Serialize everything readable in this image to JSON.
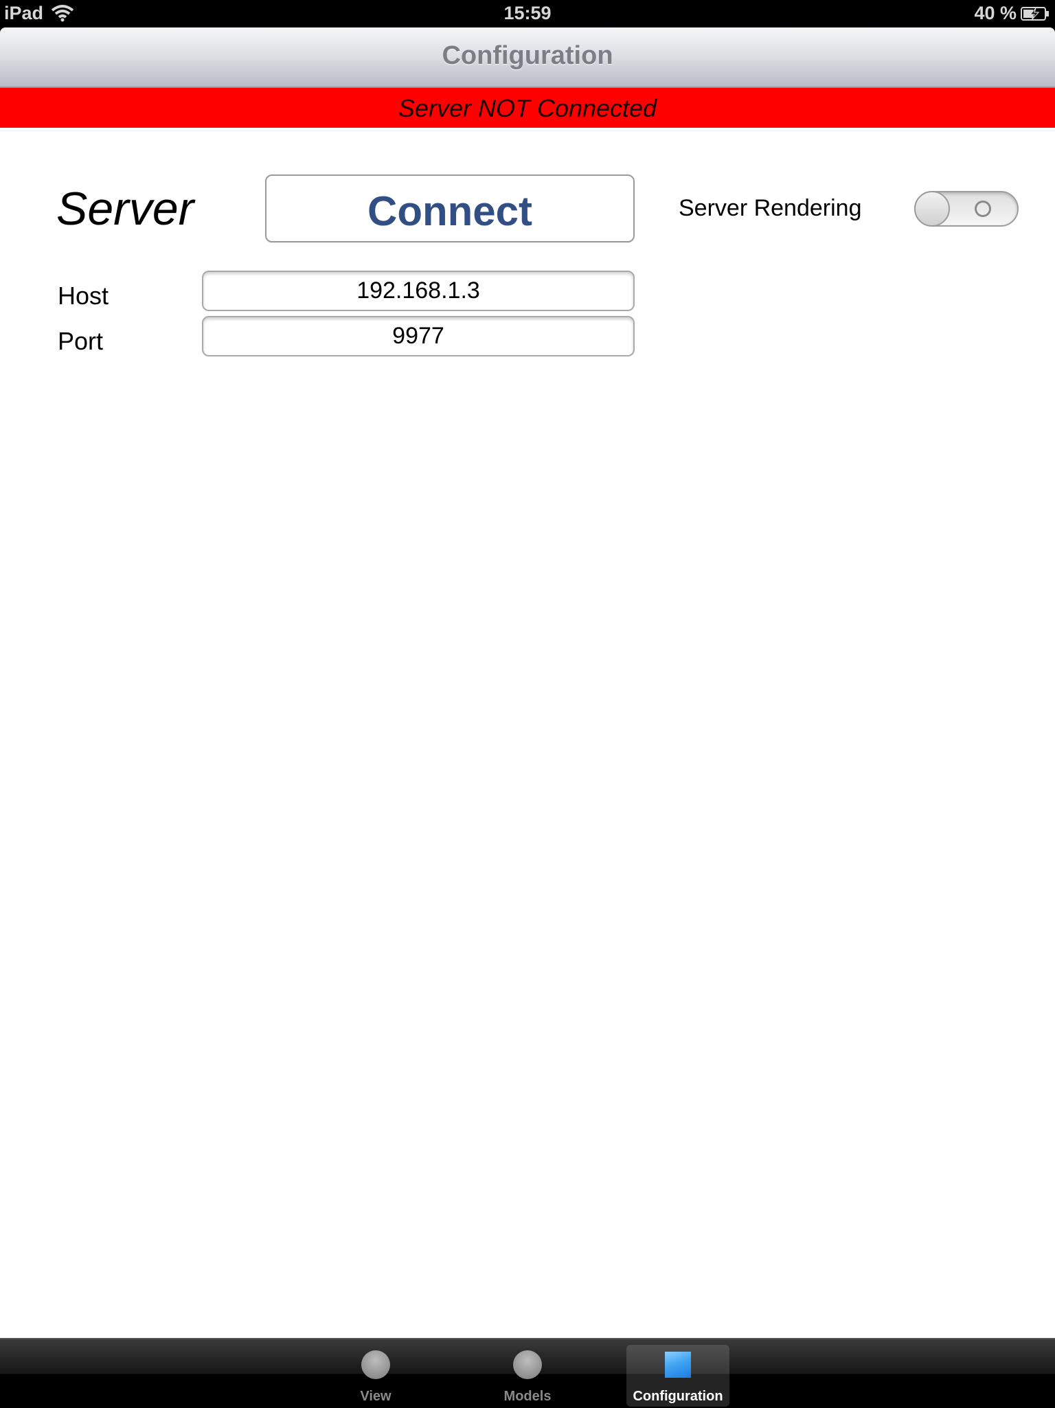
{
  "status_bar": {
    "carrier": "iPad",
    "time": "15:59",
    "battery": "40 %",
    "wifi_icon": "wifi-icon",
    "battery_icon": "battery-charging-icon"
  },
  "nav": {
    "title": "Configuration"
  },
  "banner": {
    "text": "Server NOT Connected",
    "color": "#ff0000"
  },
  "server": {
    "heading": "Server",
    "connect_label": "Connect",
    "rendering_label": "Server Rendering",
    "rendering_enabled": false
  },
  "fields": {
    "host_label": "Host",
    "host_value": "192.168.1.3",
    "port_label": "Port",
    "port_value": "9977"
  },
  "tabs": [
    {
      "label": "View",
      "icon": "circle-icon",
      "selected": false
    },
    {
      "label": "Models",
      "icon": "circle-icon",
      "selected": false
    },
    {
      "label": "Configuration",
      "icon": "square-icon",
      "selected": true
    }
  ],
  "colors": {
    "accent": "#324f85",
    "selected_tab_icon": "#41a5f2"
  }
}
